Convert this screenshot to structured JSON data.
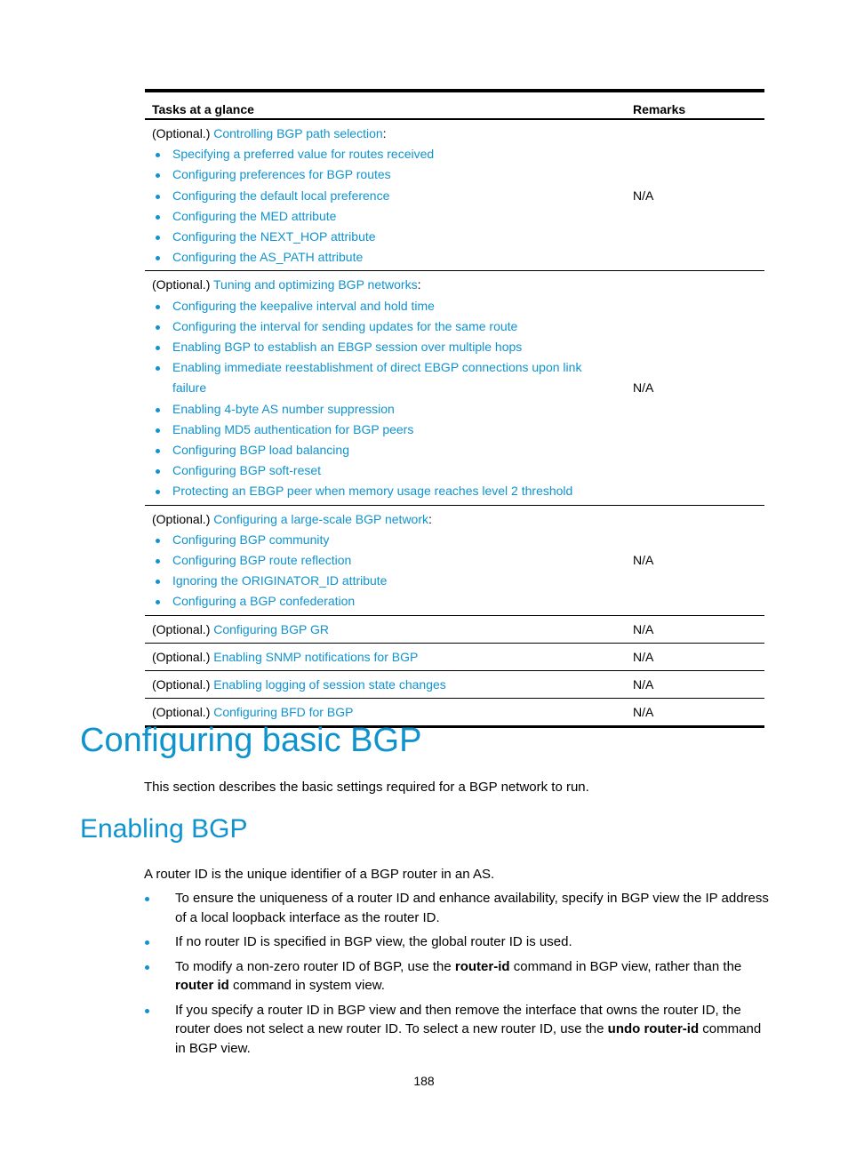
{
  "table": {
    "headers": {
      "tasks": "Tasks at a glance",
      "remarks": "Remarks"
    },
    "rows": [
      {
        "prefix": "(Optional.) ",
        "link": "Controlling BGP path selection",
        "suffix": ":",
        "items": [
          "Specifying a preferred value for routes received",
          "Configuring preferences for BGP routes",
          "Configuring the default local preference",
          "Configuring the MED attribute",
          "Configuring the NEXT_HOP attribute",
          "Configuring the AS_PATH attribute"
        ],
        "remark": "N/A"
      },
      {
        "prefix": "(Optional.) ",
        "link": "Tuning and optimizing BGP networks",
        "suffix": ":",
        "items": [
          "Configuring the keepalive interval and hold time",
          "Configuring the interval for sending updates for the same route",
          "Enabling BGP to establish an EBGP session over multiple hops",
          "Enabling immediate reestablishment of direct EBGP connections upon link failure",
          "Enabling 4-byte AS number suppression",
          "Enabling MD5 authentication for BGP peers",
          "Configuring BGP load balancing",
          "Configuring BGP soft-reset",
          "Protecting an EBGP peer when memory usage reaches level 2 threshold"
        ],
        "remark": "N/A"
      },
      {
        "prefix": "(Optional.) ",
        "link": "Configuring a large-scale BGP network",
        "suffix": ":",
        "items": [
          "Configuring BGP community",
          "Configuring BGP route reflection",
          "Ignoring the ORIGINATOR_ID attribute",
          "Configuring a BGP confederation"
        ],
        "remark": "N/A"
      },
      {
        "prefix": "(Optional.) ",
        "link": "Configuring BGP GR",
        "suffix": "",
        "items": [],
        "remark": "N/A"
      },
      {
        "prefix": "(Optional.) ",
        "link": "Enabling SNMP notifications for BGP",
        "suffix": "",
        "items": [],
        "remark": "N/A"
      },
      {
        "prefix": "(Optional.) ",
        "link": "Enabling logging of session state changes",
        "suffix": "",
        "items": [],
        "remark": "N/A"
      },
      {
        "prefix": "(Optional.) ",
        "link": "Configuring BFD for BGP",
        "suffix": "",
        "items": [],
        "remark": "N/A"
      }
    ]
  },
  "section": {
    "title": "Configuring basic BGP",
    "intro": "This section describes the basic settings required for a BGP network to run."
  },
  "subsection": {
    "title": "Enabling BGP",
    "intro": "A router ID is the unique identifier of a BGP router in an AS.",
    "bullets": [
      [
        {
          "t": "To ensure the uniqueness of a router ID and enhance availability, specify in BGP view the IP address of a local loopback interface as the router ID."
        }
      ],
      [
        {
          "t": "If no router ID is specified in BGP view, the global router ID is used."
        }
      ],
      [
        {
          "t": "To modify a non-zero router ID of BGP, use the "
        },
        {
          "t": "router-id",
          "b": true
        },
        {
          "t": " command in BGP view, rather than the "
        },
        {
          "t": "router id",
          "b": true
        },
        {
          "t": " command in system view."
        }
      ],
      [
        {
          "t": "If you specify a router ID in BGP view and then remove the interface that owns the router ID, the router does not select a new router ID. To select a new router ID, use the "
        },
        {
          "t": "undo router-id",
          "b": true
        },
        {
          "t": " command in BGP view."
        }
      ]
    ]
  },
  "page_number": "188"
}
